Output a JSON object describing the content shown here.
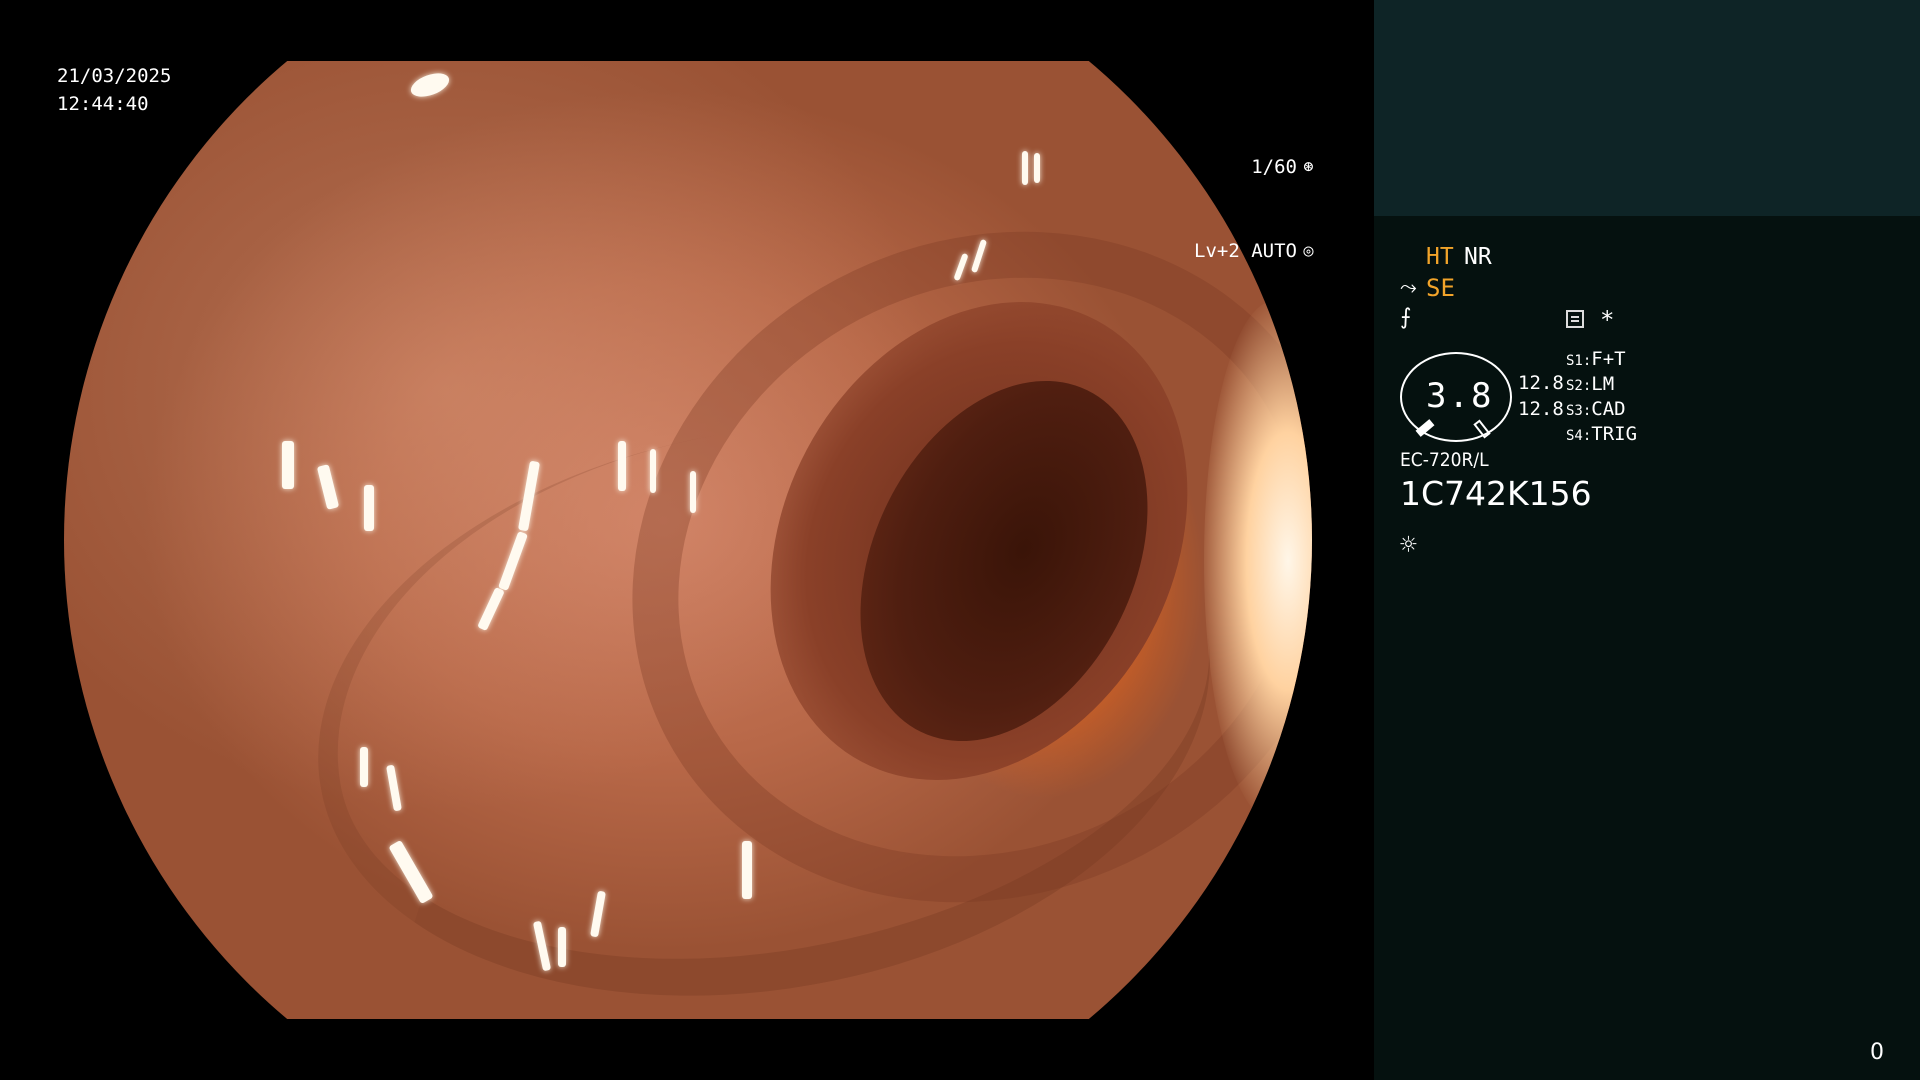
{
  "overlay": {
    "date": "21/03/2025",
    "time": "12:44:40",
    "shutter": "1/60",
    "shutter_icon": "aperture-icon",
    "level": "Lv+2 AUTO",
    "level_icon": "iris-icon"
  },
  "info": {
    "modes": {
      "ht": "HT",
      "nr": "NR",
      "se": "SE",
      "se_icon": "scope-tip-icon",
      "f_icon": "slashed-f-icon",
      "memo_icon": "memo-icon",
      "asterisk": "*"
    },
    "gauge": {
      "value": "3.8",
      "right_top": "12.8",
      "right_bottom": "12.8"
    },
    "switches": [
      {
        "key": "S1:",
        "label": "F+T"
      },
      {
        "key": "S2:",
        "label": "LM"
      },
      {
        "key": "S3:",
        "label": "CAD"
      },
      {
        "key": "S4:",
        "label": "TRIG"
      }
    ],
    "scope_model": "EC-720R/L",
    "scope_serial": "1C742K156",
    "light_icon": "sun-icon"
  },
  "counter": "0",
  "colors": {
    "panel_bg": "#05110f",
    "thumb_bg": "#0e2426",
    "accent_amber": "#f2a42a",
    "text": "#ffffff"
  }
}
